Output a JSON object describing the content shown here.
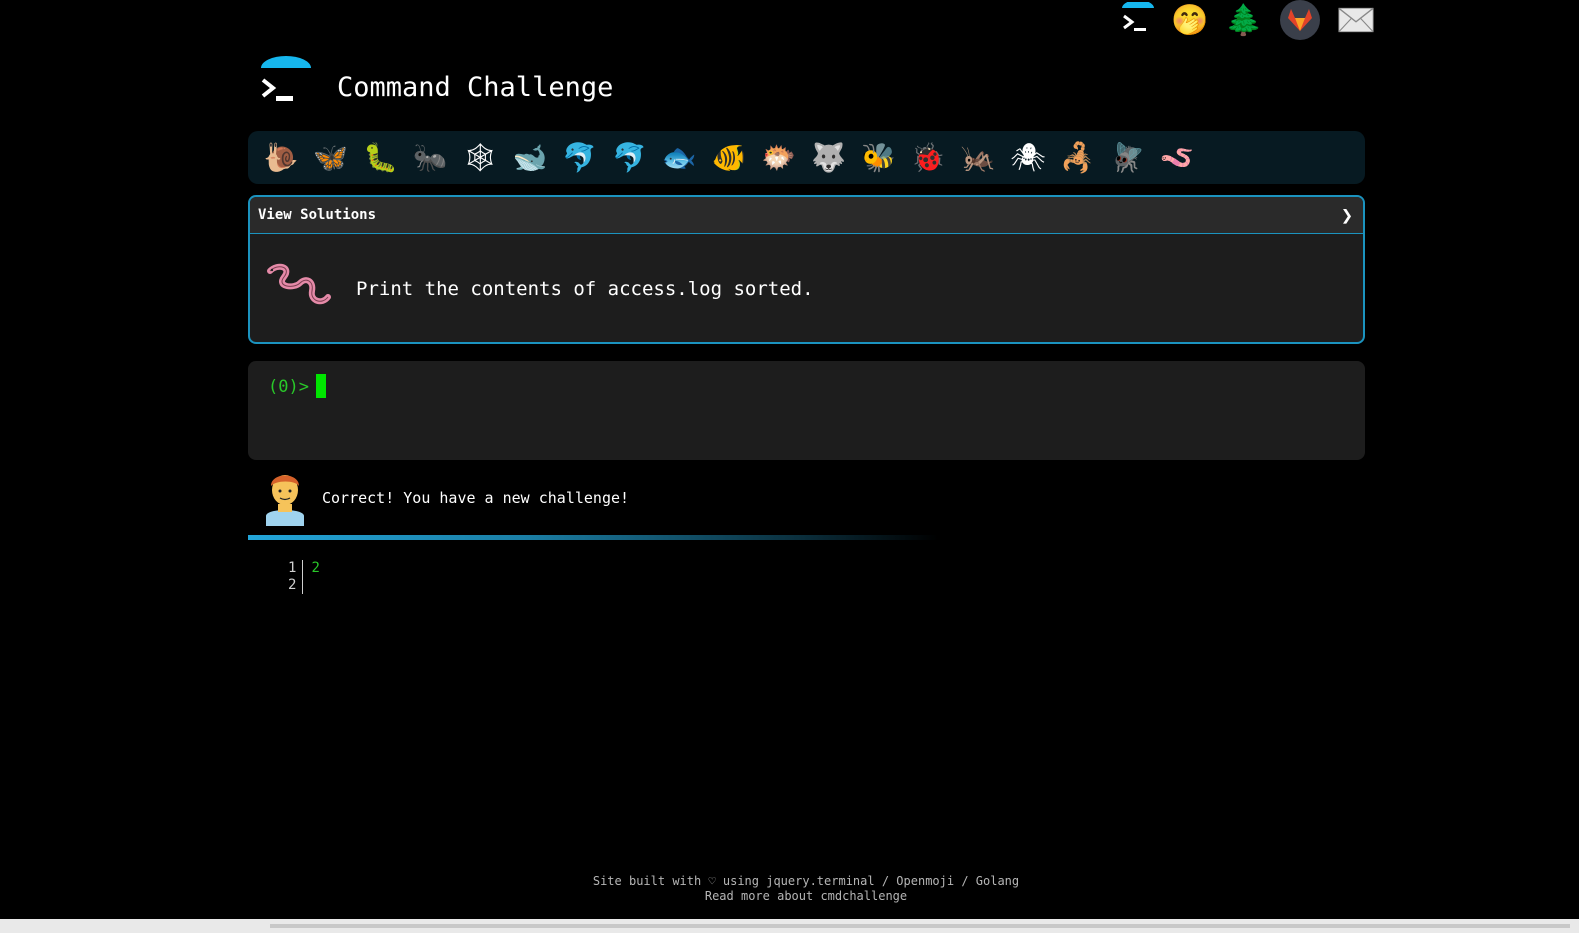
{
  "app": {
    "title": "Command Challenge"
  },
  "topnav": {
    "icons": [
      {
        "name": "terminal-logo-icon",
        "glyph": "terminal"
      },
      {
        "name": "shushing-face-icon",
        "glyph": "🤭"
      },
      {
        "name": "evergreen-tree-icon",
        "glyph": "🌲"
      },
      {
        "name": "gitlab-icon",
        "glyph": "🦊"
      },
      {
        "name": "envelope-icon",
        "glyph": "✉"
      }
    ]
  },
  "emoji_bar": {
    "items": [
      {
        "name": "snail",
        "glyph": "🐌"
      },
      {
        "name": "butterfly",
        "glyph": "🦋"
      },
      {
        "name": "caterpillar",
        "glyph": "🐛"
      },
      {
        "name": "ant",
        "glyph": "🐜"
      },
      {
        "name": "spider-web",
        "glyph": "🕸"
      },
      {
        "name": "whale",
        "glyph": "🐋"
      },
      {
        "name": "dolphin-blue",
        "glyph": "🐬"
      },
      {
        "name": "dolphin-grey",
        "glyph": "🐬"
      },
      {
        "name": "fish",
        "glyph": "🐟"
      },
      {
        "name": "tropical-fish",
        "glyph": "🐠"
      },
      {
        "name": "blowfish",
        "glyph": "🐡"
      },
      {
        "name": "wolf",
        "glyph": "🐺"
      },
      {
        "name": "bee",
        "glyph": "🐝"
      },
      {
        "name": "ladybug",
        "glyph": "🐞"
      },
      {
        "name": "cricket",
        "glyph": "🦗"
      },
      {
        "name": "spider",
        "glyph": "🕷"
      },
      {
        "name": "scorpion",
        "glyph": "🦂"
      },
      {
        "name": "fly",
        "glyph": "🪰"
      },
      {
        "name": "worm",
        "glyph": "🪱"
      }
    ]
  },
  "challenge": {
    "view_solutions_label": "View Solutions",
    "chevron": "❯",
    "task": "Print the contents of access.log sorted."
  },
  "terminal": {
    "prompt": "(0)>"
  },
  "feedback": {
    "message": "Correct! You have a new challenge!"
  },
  "output": {
    "line_numbers": [
      "1",
      "2"
    ],
    "lines": [
      "2",
      ""
    ]
  },
  "footer": {
    "prefix": "Site built with ♡ using ",
    "link1": "jquery.terminal",
    "sep1": " / ",
    "link2": "Openmoji",
    "sep2": " / ",
    "link3": "Golang",
    "read_more": "Read more about cmdchallenge"
  },
  "colors": {
    "accent": "#1b93bf",
    "prompt_green": "#29c729",
    "cursor_green": "#00e500",
    "panel_bg": "#1d1d1d",
    "emoji_bar_bg": "#071a22"
  }
}
